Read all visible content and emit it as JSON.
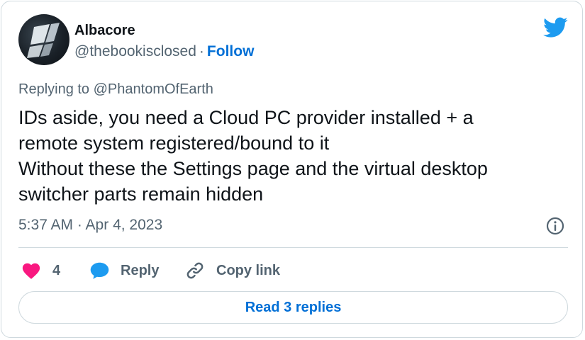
{
  "author": {
    "name": "Albacore",
    "handle": "@thebookisclosed",
    "separator": "·",
    "follow_label": "Follow"
  },
  "reply_context": {
    "prefix": "Replying to",
    "mention": "@PhantomOfEarth"
  },
  "tweet": {
    "lines": [
      "IDs aside, you need a Cloud PC provider installed + a",
      "remote system registered/bound to it",
      "Without these the Settings page and the virtual desktop",
      "switcher parts remain hidden"
    ],
    "timestamp": "5:37 AM · Apr 4, 2023"
  },
  "actions": {
    "like_count": "4",
    "reply_label": "Reply",
    "copy_link_label": "Copy link"
  },
  "read_replies_label": "Read 3 replies",
  "icons": {
    "logo": "twitter-bird-icon",
    "info": "info-icon",
    "like": "heart-icon",
    "reply": "speech-bubble-icon",
    "copy": "link-icon"
  },
  "colors": {
    "brand_blue": "#1d9bf0",
    "link_blue": "#006fd6",
    "heart_pink": "#f91880",
    "text_primary": "#0f1419",
    "text_secondary": "#536471",
    "border": "#cfd9de"
  }
}
